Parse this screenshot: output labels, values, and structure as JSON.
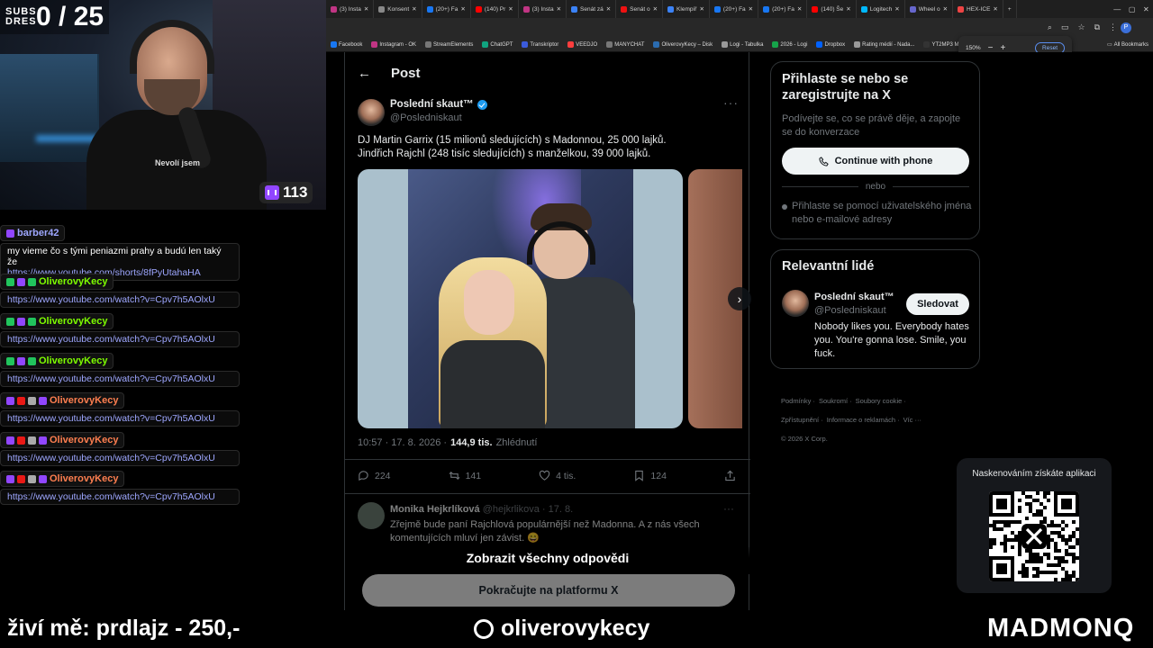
{
  "overlay": {
    "subs_label": "SUBS DRES",
    "subs_count": "0 / 25",
    "viewer_count": "113",
    "shirt_text": "Nevolí jsem",
    "footer_left": "živí mě: prdlajz - 250,-",
    "footer_center": "oliverovykecy",
    "footer_right": "MADMONQ",
    "chat": [
      {
        "user": "barber42",
        "color": "#9ea7ff",
        "lines": [
          "my vieme čo s tými peniazmi prahy a budú len taký že"
        ],
        "link": "https://www.youtube.com/shorts/8fPyUtahaHA"
      },
      {
        "user": "OliverovyKecy",
        "color": "#7fff00",
        "lines": [],
        "link": "https://www.youtube.com/watch?v=Cpv7h5AOlxU"
      },
      {
        "user": "OliverovyKecy",
        "color": "#7fff00",
        "lines": [],
        "link": "https://www.youtube.com/watch?v=Cpv7h5AOlxU"
      },
      {
        "user": "OliverovyKecy",
        "color": "#7fff00",
        "lines": [],
        "link": "https://www.youtube.com/watch?v=Cpv7h5AOlxU"
      },
      {
        "user": "OliverovyKecy",
        "color": "#ff7f50",
        "lines": [],
        "link": "https://www.youtube.com/watch?v=Cpv7h5AOlxU"
      },
      {
        "user": "OliverovyKecy",
        "color": "#ff7f50",
        "lines": [],
        "link": "https://www.youtube.com/watch?v=Cpv7h5AOlxU"
      },
      {
        "user": "OliverovyKecy",
        "color": "#ff7f50",
        "lines": [],
        "link": "https://www.youtube.com/watch?v=Cpv7h5AOlxU"
      }
    ]
  },
  "browser": {
    "tabs": [
      "(3) Insta",
      "Konsent",
      "(20+) Fa",
      "(140) Pr",
      "(3) Insta",
      "Senát zá",
      "Senát o",
      "Klempíř",
      "(20+) Fa",
      "(20+) Fa",
      "(140) Še",
      "Logitech",
      "Wheel o",
      "HEX-ICE"
    ],
    "bookmarks": [
      "Facebook",
      "Instagram - OK",
      "StreamElements",
      "ChatGPT",
      "Transkriptor",
      "VEEDJO",
      "MANYCHAT",
      "OliverovyKecy – Disk",
      "Logi - Tabulka",
      "2026 - Logi",
      "Dropbox",
      "Rating médií - Nada...",
      "YT2MP3 Magic"
    ],
    "all_bookmarks": "All Bookmarks",
    "zoom_level": "150%",
    "zoom_reset": "Reset"
  },
  "post": {
    "header_title": "Post",
    "author_name": "Poslední skaut™",
    "author_handle": "@Posledniskaut",
    "text_line1": "DJ Martin Garrix (15 milionů sledujících) s Madonnou, 25 000 lajků.",
    "text_line2": "Jindřich Rajchl (248 tisíc sledujících) s manželkou, 39 000 lajků.",
    "timestamp": "10:57 · 17. 8. 2026 ·",
    "views_count": "144,9 tis.",
    "views_label": "Zhlédnutí",
    "replies": "224",
    "reposts": "141",
    "likes": "4 tis.",
    "bookmarks": "124",
    "reply": {
      "name": "Monika Hejkrlíková",
      "handle": "@hejkrlikova · 17. 8.",
      "text": "Zřejmě bude paní Rajchlová populárnější než Madonna. A z nás všech komentujících mluví jen závist. 😄"
    },
    "show_all": "Zobrazit všechny odpovědi",
    "continue": "Pokračujte na platformu X"
  },
  "sidebar": {
    "login_title": "Přihlaste se nebo se zaregistrujte na X",
    "login_sub": "Podívejte se, co se právě děje, a zapojte se do konverzace",
    "phone_button": "Continue with phone",
    "or": "nebo",
    "user_login": "Přihlaste se pomocí uživatelského jména nebo e-mailové adresy",
    "related_title": "Relevantní lidé",
    "related_name": "Poslední skaut™",
    "related_handle": "@Posledniskaut",
    "follow": "Sledovat",
    "related_bio": "Nobody likes you. Everybody hates you. You're gonna lose. Smile, you fuck.",
    "footer_links": [
      "Podmínky ·",
      "Soukromí ·",
      "Soubory cookie ·",
      "Zpřístupnění ·",
      "Informace o reklamách ·",
      "Víc ···",
      "© 2026 X Corp."
    ],
    "qr_label": "Naskenováním získáte aplikaci"
  },
  "colors": {
    "accent": "#1d9bf0",
    "twitch": "#9146ff"
  }
}
